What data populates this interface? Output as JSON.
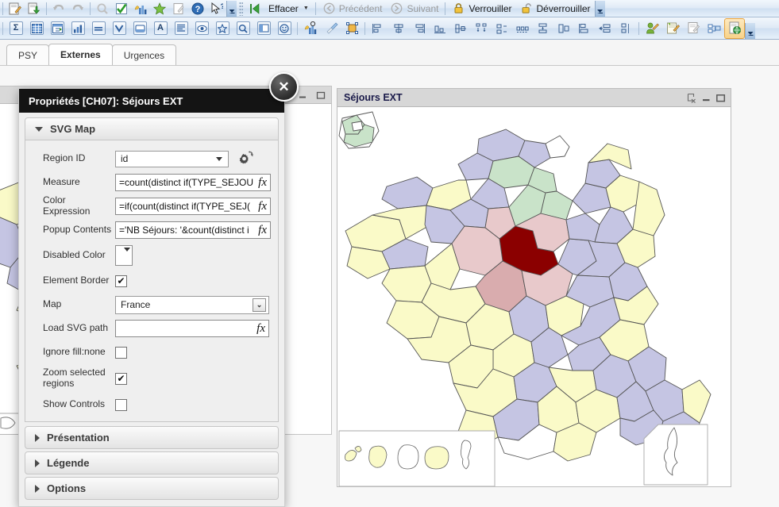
{
  "toolbars": {
    "row1": {
      "buttons": [
        {
          "name": "edit-icon",
          "glyph": "edit"
        },
        {
          "name": "export-icon",
          "glyph": "export"
        },
        {
          "name": "undo-icon",
          "glyph": "undo"
        },
        {
          "name": "redo-icon",
          "glyph": "redo"
        },
        {
          "name": "search-icon",
          "glyph": "magnifier"
        },
        {
          "name": "check-icon",
          "glyph": "check"
        },
        {
          "name": "chart-icon",
          "glyph": "chart"
        },
        {
          "name": "favorite-icon",
          "glyph": "star"
        },
        {
          "name": "note-icon",
          "glyph": "note"
        },
        {
          "name": "help-icon",
          "glyph": "help"
        },
        {
          "name": "select-pointer-icon",
          "glyph": "pointer-help"
        }
      ],
      "clear_label": "Effacer",
      "back_label": "Précédent",
      "forward_label": "Suivant",
      "lock_label": "Verrouiller",
      "unlock_label": "Déverrouiller"
    },
    "row2": {
      "buttons": [
        {
          "name": "sum-icon",
          "label": "Σ"
        },
        {
          "name": "table-icon",
          "label": "grid"
        },
        {
          "name": "pivot-icon",
          "label": "pivot"
        },
        {
          "name": "bar-chart-icon",
          "label": "bars"
        },
        {
          "name": "text-object-icon",
          "label": "eq"
        },
        {
          "name": "listbox-icon",
          "label": "V"
        },
        {
          "name": "button-object-icon",
          "label": "btn"
        },
        {
          "name": "text-icon",
          "label": "A"
        },
        {
          "name": "list-icon",
          "label": "list"
        },
        {
          "name": "current-selections-icon",
          "label": "eye"
        },
        {
          "name": "bookmark-star-icon",
          "label": "star"
        },
        {
          "name": "search-object-icon",
          "label": "Q"
        },
        {
          "name": "container-icon",
          "label": "cont"
        },
        {
          "name": "smiley-icon",
          "label": "face"
        },
        {
          "name": "chart-wizard-icon",
          "label": "wiz"
        },
        {
          "name": "clear-format-icon",
          "label": "brush"
        },
        {
          "name": "object-frame-icon",
          "label": "frame"
        },
        {
          "name": "align-left-icon",
          "label": "al"
        },
        {
          "name": "align-center-h-icon",
          "label": "ac"
        },
        {
          "name": "align-right-icon",
          "label": "ar"
        },
        {
          "name": "align-bottom-icon",
          "label": "ab"
        },
        {
          "name": "align-middle-icon",
          "label": "am"
        },
        {
          "name": "distribute-h-icon",
          "label": "dh"
        },
        {
          "name": "distribute-v-icon",
          "label": "dv"
        },
        {
          "name": "space-h-icon",
          "label": "sh"
        },
        {
          "name": "space-v-icon",
          "label": "sv"
        },
        {
          "name": "resize-icon",
          "label": "rz"
        },
        {
          "name": "user-edit-icon",
          "label": "user"
        },
        {
          "name": "sheet-properties-icon",
          "label": "sheet"
        },
        {
          "name": "document-properties-icon",
          "label": "doc"
        },
        {
          "name": "layout-icon",
          "label": "lay"
        },
        {
          "name": "publish-web-icon",
          "label": "web"
        }
      ]
    }
  },
  "tabs": [
    {
      "label": "PSY",
      "active": false
    },
    {
      "label": "Externes",
      "active": true
    },
    {
      "label": "Urgences",
      "active": false
    }
  ],
  "dialog": {
    "title": "Propriétés [CH07]: Séjours EXT",
    "close_glyph": "✕",
    "sections": [
      {
        "label": "SVG Map",
        "expanded": true
      },
      {
        "label": "Présentation",
        "expanded": false
      },
      {
        "label": "Légende",
        "expanded": false
      },
      {
        "label": "Options",
        "expanded": false
      }
    ],
    "fields": {
      "region_id": {
        "label": "Region ID",
        "value": "id",
        "type": "combo"
      },
      "measure": {
        "label": "Measure",
        "value": "=count(distinct if(TYPE_SEJOU",
        "type": "expr",
        "fx": "fx"
      },
      "color_expression": {
        "label": "Color Expression",
        "value": "=if(count(distinct if(TYPE_SEJ(",
        "type": "expr",
        "fx": "fx"
      },
      "popup_contents": {
        "label": "Popup Contents",
        "value": "='NB Séjours: '&count(distinct i",
        "type": "expr",
        "fx": "fx"
      },
      "disabled_color": {
        "label": "Disabled Color",
        "value": "",
        "type": "color"
      },
      "element_border": {
        "label": "Element Border",
        "checked": true,
        "type": "checkbox",
        "mark": "✔"
      },
      "map": {
        "label": "Map",
        "value": "France",
        "type": "select"
      },
      "load_svg_path": {
        "label": "Load SVG path",
        "value": "",
        "type": "expr",
        "fx": "fx"
      },
      "ignore_fill_none": {
        "label": "Ignore fill:none",
        "checked": false,
        "type": "checkbox",
        "mark": ""
      },
      "zoom_selected_regions": {
        "label": "Zoom selected regions",
        "checked": true,
        "type": "checkbox",
        "mark": "✔"
      },
      "show_controls": {
        "label": "Show Controls",
        "checked": false,
        "type": "checkbox",
        "mark": ""
      }
    }
  },
  "map_panel": {
    "title": "Séjours EXT",
    "controls": [
      "clear-selections-icon",
      "minimize-icon",
      "maximize-icon"
    ]
  },
  "colors": {
    "selected_region": "#8B0000",
    "rose_light": "#E8C9CB",
    "rose_mid": "#D9ACAE",
    "green_light": "#C9E3C9",
    "lavender": "#C5C5E3",
    "pale_yellow": "#FAFAC8",
    "white_region": "#FFFFFF",
    "stroke": "#555555",
    "titlebar_bg": "#141414",
    "panel_header_bg": "#D7D7D7"
  }
}
